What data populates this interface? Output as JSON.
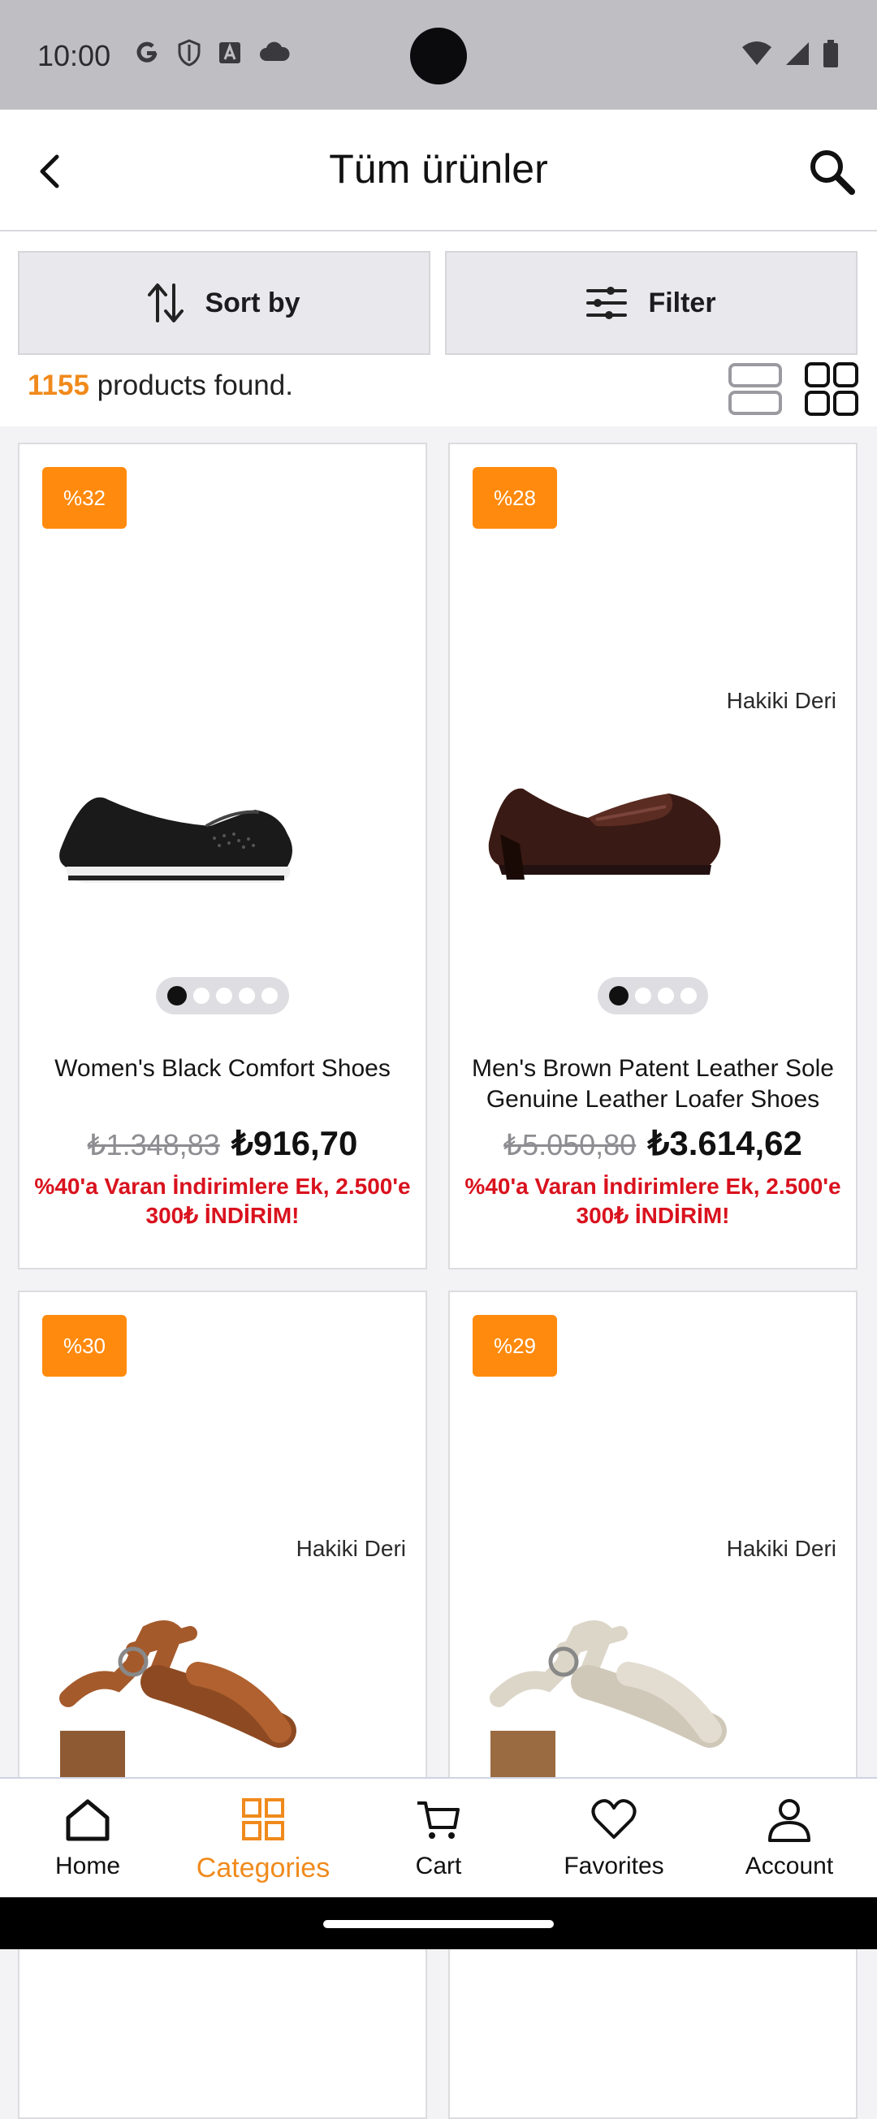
{
  "status_bar": {
    "time": "10:00",
    "left_icons": [
      "google-icon",
      "shield-icon",
      "font-a-icon",
      "cloud-icon"
    ],
    "right_icons": [
      "wifi-icon",
      "signal-icon",
      "battery-icon"
    ]
  },
  "app_bar": {
    "title": "Tüm ürünler",
    "back_icon": "back-arrow-icon",
    "search_icon": "search-icon"
  },
  "controls": {
    "sort_label": "Sort by",
    "filter_label": "Filter",
    "count_value": "1155",
    "count_text": " products found."
  },
  "products": [
    {
      "badge": "%32",
      "name": "Women's Black Comfort Shoes",
      "old_price": "₺1.348,83",
      "new_price": "₺916,70",
      "promo": "%40'a Varan İndirimlere Ek, 2.500'e 300₺ İNDİRİM!",
      "overlay_text": ""
    },
    {
      "badge": "%28",
      "name": "Men's Brown Patent Leather Sole Genuine Leather Loafer Shoes",
      "old_price": "₺5.050,80",
      "new_price": "₺3.614,62",
      "promo": "%40'a Varan İndirimlere Ek, 2.500'e 300₺ İNDİRİM!",
      "overlay_text": "Hakiki Deri"
    },
    {
      "badge": "%30",
      "overlay_text": "Hakiki Deri"
    },
    {
      "badge": "%29",
      "overlay_text": "Hakiki Deri"
    }
  ],
  "bottom_nav": [
    {
      "label": "Home",
      "icon": "home-icon"
    },
    {
      "label": "Categories",
      "icon": "grid-icon"
    },
    {
      "label": "Cart",
      "icon": "cart-icon"
    },
    {
      "label": "Favorites",
      "icon": "heart-icon"
    },
    {
      "label": "Account",
      "icon": "person-icon"
    }
  ],
  "colors": {
    "accent": "#ff8a0d",
    "promo_red": "#d9121e",
    "count_orange": "#f08a1c"
  }
}
